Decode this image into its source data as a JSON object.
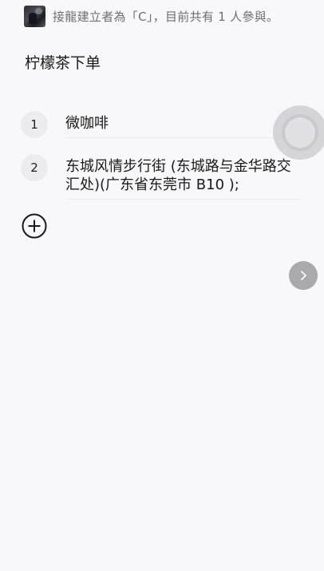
{
  "header": {
    "avatar_icon": "user-avatar",
    "text": "接龍建立者為「C」，目前共有 1 人參與。"
  },
  "title": "柠檬茶下单",
  "items": [
    {
      "number": "1",
      "text": "微咖啡"
    },
    {
      "number": "2",
      "text": "东城风情步行街 (东城路与金华路交汇处)(广东省东莞市 B10 );"
    }
  ],
  "add_button_icon": "plus-circle-icon",
  "floating_button_icon": "assistive-touch-icon",
  "next_button_icon": "chevron-right-icon",
  "colors": {
    "background": "#f8f8fa",
    "header_text": "#6e6e73",
    "number_badge": "#ececef",
    "next_button": "#a9a9ae"
  }
}
